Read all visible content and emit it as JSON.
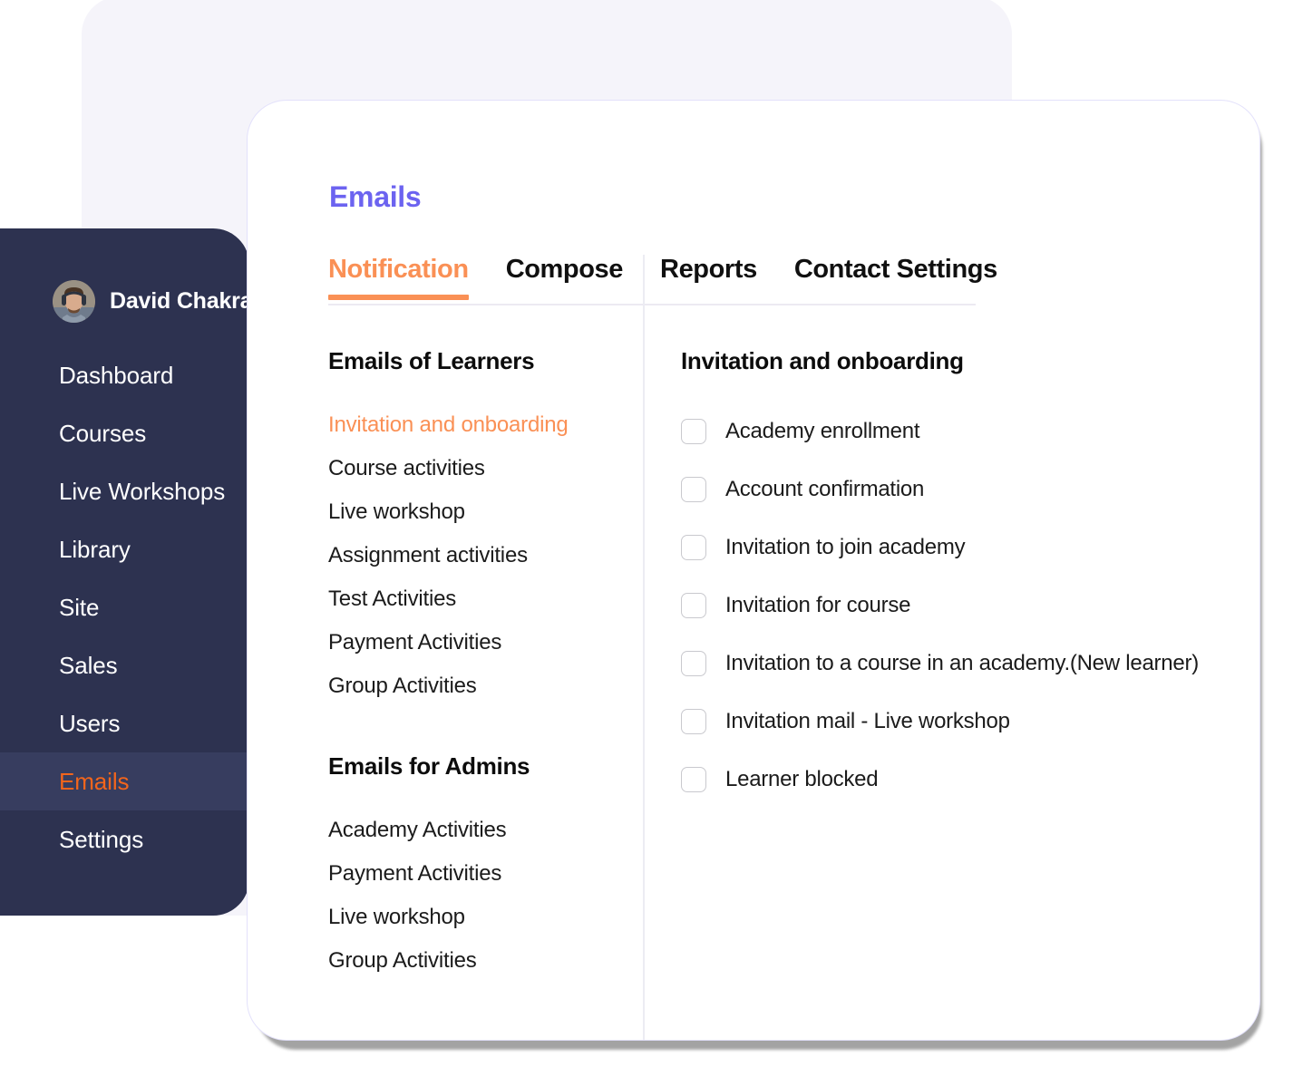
{
  "colors": {
    "sidebar_bg": "#2d3250",
    "sidebar_active_bg": "#373d5f",
    "accent_orange": "#fa9055",
    "sidebar_active_text": "#f2651c",
    "title_purple": "#6c63f0",
    "backdrop_panel": "#f5f4fa",
    "card_bg": "#ffffff",
    "divider": "#ececf3",
    "checkbox_border": "#c9c9ce"
  },
  "sidebar": {
    "user": {
      "name": "David Chakra",
      "avatar_icon": "user-avatar-photo"
    },
    "items": [
      {
        "label": "Dashboard",
        "active": false
      },
      {
        "label": "Courses",
        "active": false
      },
      {
        "label": "Live Workshops",
        "active": false
      },
      {
        "label": "Library",
        "active": false
      },
      {
        "label": "Site",
        "active": false
      },
      {
        "label": "Sales",
        "active": false
      },
      {
        "label": "Users",
        "active": false
      },
      {
        "label": "Emails",
        "active": true
      },
      {
        "label": "Settings",
        "active": false
      }
    ]
  },
  "main": {
    "page_title": "Emails",
    "tabs": [
      {
        "label": "Notification",
        "active": true
      },
      {
        "label": "Compose",
        "active": false
      },
      {
        "label": "Reports",
        "active": false
      },
      {
        "label": "Contact Settings",
        "active": false
      }
    ],
    "left_column": {
      "groups": [
        {
          "heading": "Emails of Learners",
          "links": [
            {
              "label": "Invitation and onboarding",
              "active": true
            },
            {
              "label": "Course activities",
              "active": false
            },
            {
              "label": "Live workshop",
              "active": false
            },
            {
              "label": "Assignment activities",
              "active": false
            },
            {
              "label": "Test Activities",
              "active": false
            },
            {
              "label": "Payment Activities",
              "active": false
            },
            {
              "label": "Group Activities",
              "active": false
            }
          ]
        },
        {
          "heading": "Emails for Admins",
          "links": [
            {
              "label": "Academy Activities",
              "active": false
            },
            {
              "label": "Payment Activities",
              "active": false
            },
            {
              "label": "Live workshop",
              "active": false
            },
            {
              "label": "Group Activities",
              "active": false
            }
          ]
        }
      ]
    },
    "right_column": {
      "heading": "Invitation and onboarding",
      "options": [
        {
          "label": "Academy enrollment",
          "checked": false
        },
        {
          "label": "Account confirmation",
          "checked": false
        },
        {
          "label": "Invitation to join academy",
          "checked": false
        },
        {
          "label": "Invitation for course",
          "checked": false
        },
        {
          "label": "Invitation to a course in an academy.(New learner)",
          "checked": false
        },
        {
          "label": "Invitation mail - Live workshop",
          "checked": false
        },
        {
          "label": "Learner blocked",
          "checked": false
        }
      ]
    }
  }
}
